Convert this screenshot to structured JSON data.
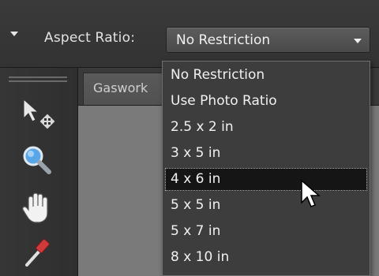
{
  "options_bar": {
    "aspect_label": "Aspect Ratio:",
    "aspect_value": "No Restriction"
  },
  "document": {
    "tab_label": "Gaswork"
  },
  "aspect_dropdown": {
    "items": [
      {
        "label": "No Restriction"
      },
      {
        "label": "Use Photo Ratio"
      },
      {
        "label": "2.5 x 2 in"
      },
      {
        "label": "3 x 5 in"
      },
      {
        "label": "4 x 6 in"
      },
      {
        "label": "5 x 5 in"
      },
      {
        "label": "5 x 7 in"
      },
      {
        "label": "8 x 10 in"
      }
    ],
    "highlighted": "4 x 6 in"
  },
  "tools": [
    {
      "icon": "move-tool-icon"
    },
    {
      "icon": "zoom-tool-icon"
    },
    {
      "icon": "hand-tool-icon"
    },
    {
      "icon": "eyedropper-tool-icon"
    }
  ],
  "colors": {
    "panel": "#2b2b2b",
    "dropdown": "#3d3d3d",
    "highlight": "#151515",
    "text": "#f1f1f1"
  }
}
